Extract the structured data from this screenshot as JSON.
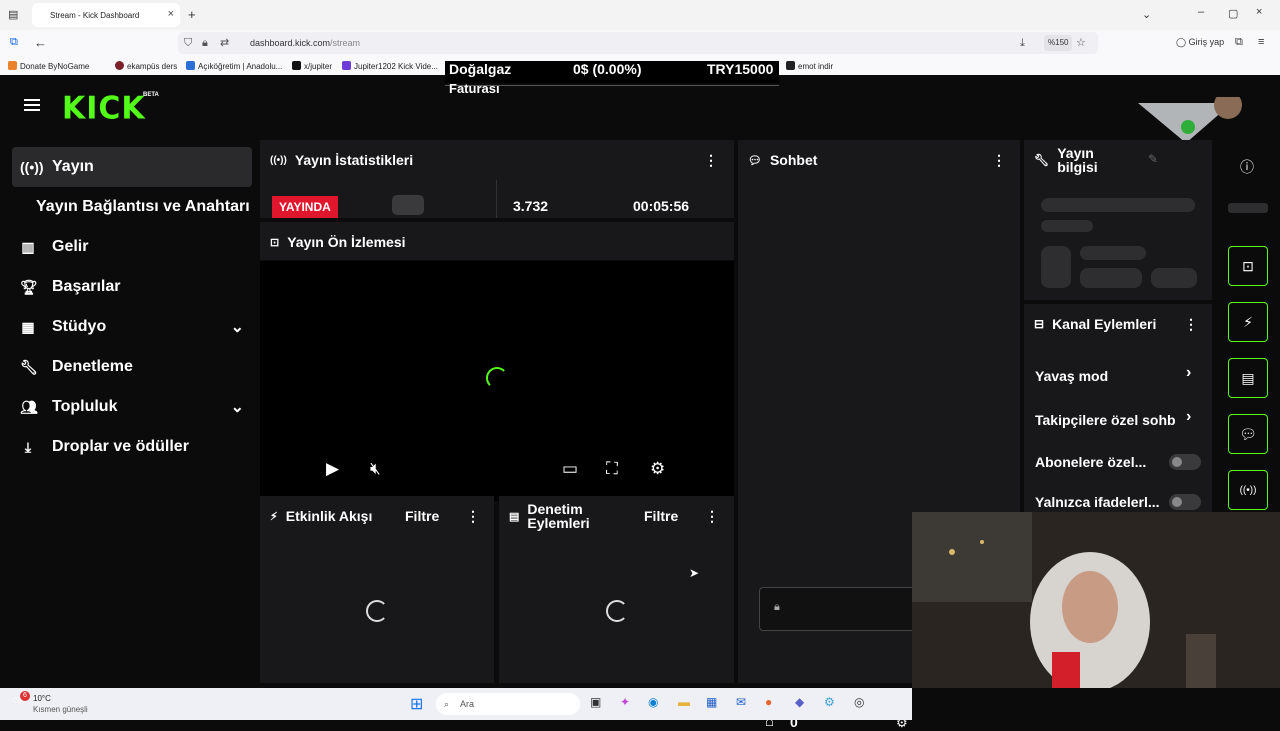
{
  "browser": {
    "tab_title": "Stream - Kick Dashboard",
    "url_domain": "dashboard.kick.com",
    "url_path": "/stream",
    "zoom": "%150",
    "login_label": "Giriş yap",
    "bookmarks": [
      "Donate ByNoGame",
      "ekampüs ders",
      "Açıköğretim | Anadolu...",
      "x/jupiter",
      "Jupiter1202 Kick Vide...",
      "emot indir"
    ]
  },
  "overlay": {
    "ticker_title": "Doğalgaz",
    "ticker_title2": "Faturası",
    "ticker_value": "0$ (0.00%)",
    "ticker_amount": "TRY15000"
  },
  "brand": {
    "logo": "KICK",
    "badge": "BETA"
  },
  "sidebar": {
    "items": [
      {
        "label": "Yayın",
        "icon": "broadcast-icon"
      },
      {
        "label": "Yayın Bağlantısı ve Anahtarı"
      },
      {
        "label": "Gelir",
        "icon": "chart-icon"
      },
      {
        "label": "Başarılar",
        "icon": "trophy-icon"
      },
      {
        "label": "Stüdyo",
        "icon": "studio-icon"
      },
      {
        "label": "Denetleme",
        "icon": "wrench-icon"
      },
      {
        "label": "Topluluk",
        "icon": "users-icon"
      },
      {
        "label": "Droplar ve ödüller",
        "icon": "download-icon"
      }
    ]
  },
  "stats": {
    "title": "Yayın İstatistikleri",
    "live_label": "YAYINDA",
    "viewers": "3.732",
    "duration": "00:05:56"
  },
  "preview": {
    "title": "Yayın Ön İzlemesi"
  },
  "activity": {
    "title": "Etkinlik Akışı",
    "filter": "Filtre"
  },
  "moderation": {
    "title": "Denetim Eylemleri",
    "filter": "Filtre"
  },
  "chat": {
    "title": "Sohbet",
    "count": "0"
  },
  "stream_info": {
    "title": "Yayın bilgisi"
  },
  "channel_actions": {
    "title": "Kanal Eylemleri",
    "items": [
      "Yavaş mod",
      "Takipçilere özel sohb",
      "Abonelere özel...",
      "Yalnızca ifadelerl..."
    ]
  },
  "taskbar": {
    "temperature": "10°C",
    "weather": "Kısmen güneşli",
    "search_placeholder": "Ara",
    "notif_count": "6"
  },
  "colors": {
    "accent": "#53fc18",
    "live": "#e0162c",
    "panel": "#18181b"
  }
}
